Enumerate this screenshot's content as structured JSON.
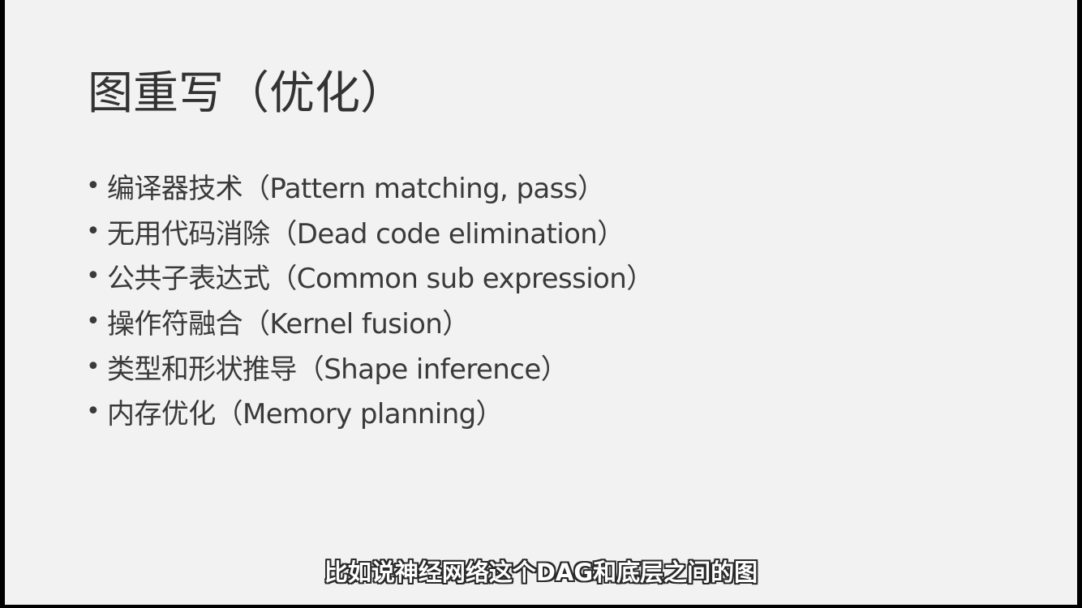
{
  "slide": {
    "title": "图重写（优化）",
    "bullets": [
      "编译器技术（Pattern matching, pass）",
      "无用代码消除（Dead code elimination）",
      "公共子表达式（Common sub expression）",
      "操作符融合（Kernel fusion）",
      "类型和形状推导（Shape inference）",
      "内存优化（Memory planning）"
    ],
    "bullet_glyph": "•"
  },
  "video": {
    "subtitle": "比如说神经网络这个DAG和底层之间的图"
  },
  "colors": {
    "slide_background": "#f2f2f2",
    "frame_background": "#000000",
    "text": "#333333"
  }
}
